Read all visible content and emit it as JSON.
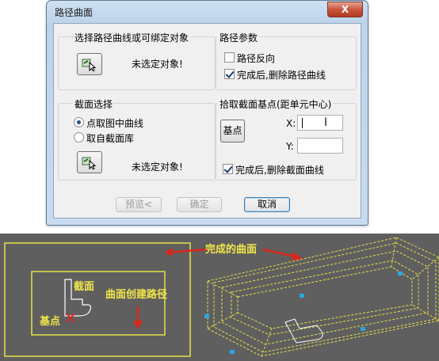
{
  "window": {
    "title": "路径曲面",
    "close_label": "X"
  },
  "group_curve": {
    "label": "选择路径曲线或可绑定对象",
    "status": "未选定对象!",
    "pick_icon": "pick-object-icon"
  },
  "group_path": {
    "label": "路径参数",
    "reverse_label": "路径反向",
    "reverse_checked": false,
    "delete_label": "完成后,删除路径曲线",
    "delete_checked": true
  },
  "group_section": {
    "label": "截面选择",
    "radio1_label": "点取图中曲线",
    "radio1_checked": true,
    "radio2_label": "取自截面库",
    "radio2_checked": false,
    "status": "未选定对象!",
    "pick_icon": "pick-object-icon"
  },
  "group_base": {
    "label": "拾取截面基点(距单元中心)",
    "base_button": "基点",
    "x_label": "X:",
    "x_value": "",
    "y_label": "Y:",
    "y_value": "",
    "delete_label": "完成后,删除截面曲线",
    "delete_checked": true
  },
  "buttons": {
    "preview": "预览<",
    "ok": "确定",
    "cancel": "取消"
  },
  "illustration": {
    "label_surface": "完成的曲面",
    "label_section": "截面",
    "label_path": "曲面创建路径",
    "label_base": "基点",
    "line_color": "#e8e04a",
    "arrow_color": "#d9271c",
    "node_color": "#29a7e0"
  }
}
